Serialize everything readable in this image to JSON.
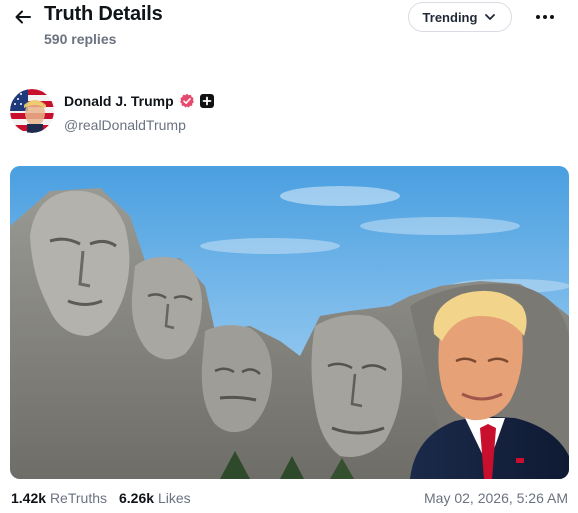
{
  "header": {
    "title": "Truth Details",
    "replies": "590 replies",
    "sort_label": "Trending",
    "back_icon": "arrow-left-icon",
    "more_icon": "more-horizontal-icon"
  },
  "author": {
    "name": "Donald J. Trump",
    "handle": "@realDonaldTrump",
    "verified_icon": "verified-badge-icon",
    "plus_icon": "plus-badge-icon",
    "verified_color": "#e5496b"
  },
  "post": {
    "image_alt": "Mount Rushmore with Donald Trump"
  },
  "stats": {
    "retruths_count": "1.42k",
    "retruths_label": "ReTruths",
    "likes_count": "6.26k",
    "likes_label": "Likes",
    "timestamp": "May 02, 2026, 5:26 AM"
  },
  "colors": {
    "text": "#0f1419",
    "muted": "#6b7280",
    "border": "#d9dde3"
  }
}
